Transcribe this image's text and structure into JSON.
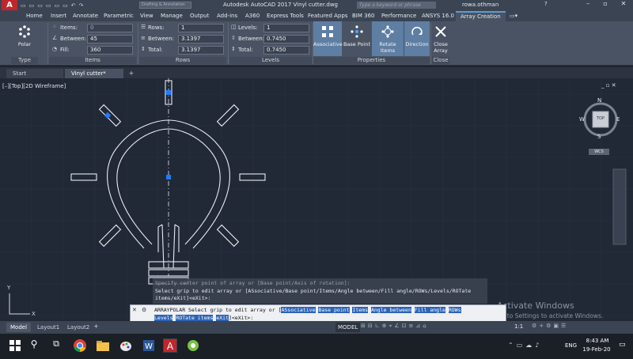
{
  "title_bar": {
    "doc_title": "Autodesk AutoCAD 2017   Vinyl cutter.dwg",
    "workspace": "Drafting & Annotation",
    "search_placeholder": "Type a keyword or phrase",
    "user": "rowa.othman"
  },
  "ribbon_tabs": [
    "Home",
    "Insert",
    "Annotate",
    "Parametric",
    "View",
    "Manage",
    "Output",
    "Add-ins",
    "A360",
    "Express Tools",
    "Featured Apps",
    "BIM 360",
    "Performance",
    "ANSYS 16.0",
    "Array Creation"
  ],
  "ribbon": {
    "type_button": "Polar",
    "items": {
      "items_label": "Items:",
      "items_value": "0",
      "between_label": "Between:",
      "between_value": "45",
      "fill_label": "Fill:",
      "fill_value": "360"
    },
    "rows": {
      "rows_label": "Rows:",
      "rows_value": "1",
      "between_label": "Between:",
      "between_value": "3.1397",
      "total_label": "Total:",
      "total_value": "3.1397"
    },
    "levels": {
      "levels_label": "Levels:",
      "levels_value": "1",
      "between_label": "Between:",
      "between_value": "0.7450",
      "total_label": "Total:",
      "total_value": "0.7450"
    },
    "properties": [
      "Associative",
      "Base Point",
      "Rotate Items",
      "Direction"
    ],
    "close_label": "Close Array",
    "panel_titles": {
      "type": "Type",
      "items": "Items",
      "rows": "Rows",
      "levels": "Levels",
      "properties": "Properties",
      "close": "Close"
    }
  },
  "doc_tabs": {
    "start": "Start",
    "active": "Vinyl cutter*"
  },
  "viewport_label": "[–][Top][2D Wireframe]",
  "viewcube": {
    "n": "N",
    "s": "S",
    "e": "E",
    "w": "W",
    "top": "TOP",
    "wcs": "WCS"
  },
  "ucs": {
    "y": "Y",
    "x": "X"
  },
  "command_history": [
    "Specify center point of array or [Base point/Axis of rotation]:",
    "Select grip to edit array or [ASsociative/Base point/Items/Angle between/Fill angle/ROWs/Levels/ROTate",
    "items/eXit]<eXit>:"
  ],
  "command_line": {
    "prefix": "ARRAYPOLAR Select grip to edit array or [",
    "keywords": [
      "ASsociative",
      "Base point",
      "Items",
      "Angle between",
      "Fill angle",
      "ROWs",
      "Levels",
      "ROTate items",
      "eXit"
    ],
    "suffix": "]<eXit>:"
  },
  "layout_tabs": [
    "Model",
    "Layout1",
    "Layout2"
  ],
  "status": {
    "model": "MODEL",
    "scale": "1:1"
  },
  "watermark": {
    "line1": "Activate Windows",
    "line2": "Go to Settings to activate Windows."
  },
  "taskbar": {
    "lang": "ENG",
    "time": "8:43 AM",
    "date": "19-Feb-20"
  },
  "colors": {
    "accent": "#c0272d",
    "ribbon_active": "#5f7ea3",
    "keyword": "#2c63b7",
    "grip": "#1e7bff"
  }
}
